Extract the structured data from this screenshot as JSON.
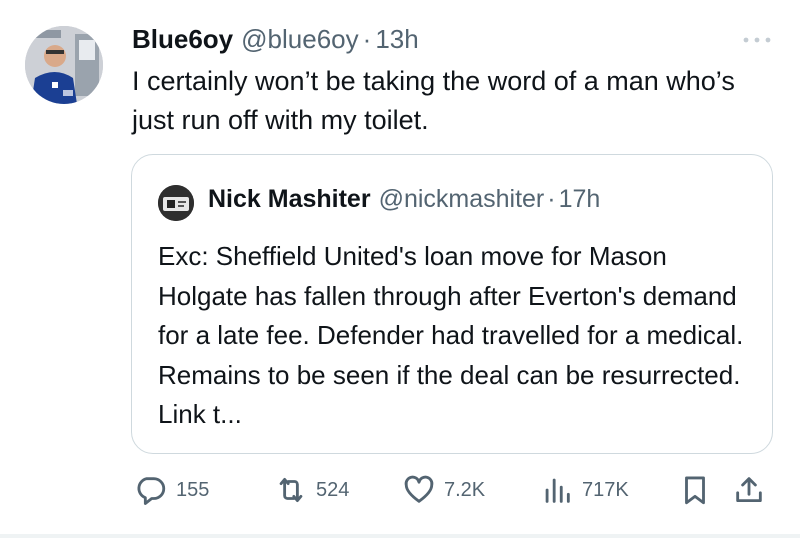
{
  "post": {
    "display_name": "Blue6oy",
    "handle": "@blue6oy",
    "separator": "·",
    "time": "13h",
    "text": "I certainly won’t be taking the word of a man who’s just run off with my toilet.",
    "avatar_icon": "avatar-photo"
  },
  "quoted": {
    "display_name": "Nick Mashiter",
    "handle": "@nickmashiter",
    "separator": "·",
    "time": "17h",
    "text": "Exc: Sheffield United's loan move for Mason Holgate has fallen through after Everton's demand for a late fee. Defender had travelled for a medical. Remains to be seen if the deal can be resurrected. Link t...",
    "avatar_icon": "avatar-photo"
  },
  "actions": {
    "replies": "155",
    "reposts": "524",
    "likes": "7.2K",
    "views": "717K",
    "icons": [
      "reply-icon",
      "repost-icon",
      "like-icon",
      "views-icon",
      "bookmark-icon",
      "share-icon"
    ]
  },
  "colors": {
    "text": "#0f1419",
    "secondary": "#536471",
    "border": "#cfd9de"
  }
}
